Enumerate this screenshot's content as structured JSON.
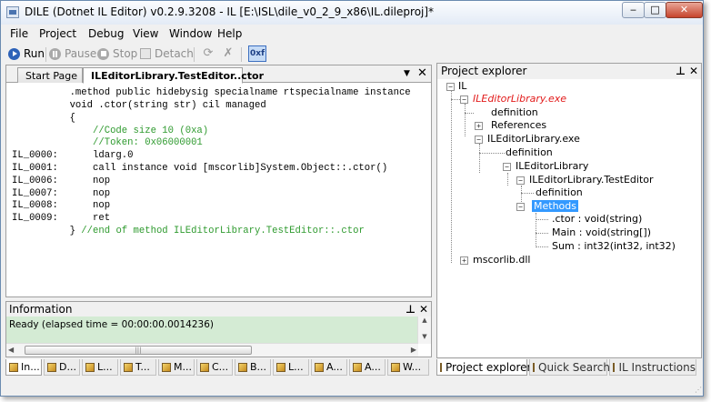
{
  "window": {
    "title": "DILE (Dotnet IL Editor) v0.2.9.3208 - IL [E:\\ISL\\dile_v0_2_9_x86\\IL.dileproj]*",
    "minimize": "‒",
    "maximize": "□",
    "close": "✕"
  },
  "menu": [
    "File",
    "Project",
    "Debug",
    "View",
    "Window",
    "Help"
  ],
  "toolbar": {
    "run": "Run",
    "pause": "Pause",
    "stop": "Stop",
    "detach": "Detach",
    "hex": "0xf"
  },
  "editor": {
    "tabs": [
      "Start Page",
      "ILEditorLibrary.TestEditor..ctor"
    ],
    "dropdown": "▼",
    "close": "✕",
    "lines": [
      {
        "text": "          .method public hidebysig specialname rtspecialname instance",
        "comment": false
      },
      {
        "text": "          void .ctor(string str) cil managed",
        "comment": false
      },
      {
        "text": "          {",
        "comment": false
      },
      {
        "text": "              //Code size 10 (0xa)",
        "comment": true
      },
      {
        "text": "              //Token: 0x06000001",
        "comment": true
      },
      {
        "text": "IL_0000:      ldarg.0",
        "comment": false
      },
      {
        "text": "IL_0001:      call instance void [mscorlib]System.Object::.ctor()",
        "comment": false
      },
      {
        "text": "IL_0006:      nop",
        "comment": false
      },
      {
        "text": "IL_0007:      nop",
        "comment": false
      },
      {
        "text": "IL_0008:      nop",
        "comment": false
      },
      {
        "text": "IL_0009:      ret",
        "comment": false
      }
    ],
    "last_line_code": "          } ",
    "last_line_comment": "//end of method ILEditorLibrary.TestEditor::.ctor"
  },
  "info": {
    "title": "Information",
    "pin": "⊥",
    "close": "✕",
    "text": "Ready (elapsed time = 00:00:00.0014236)",
    "up": "▲",
    "down": "▼",
    "left": "◀",
    "right": "▶",
    "grip": "|||"
  },
  "bottom_tabs": [
    "In...",
    "D...",
    "L...",
    "T...",
    "M...",
    "C...",
    "B...",
    "L...",
    "A...",
    "A...",
    "W..."
  ],
  "explorer": {
    "title": "Project explorer",
    "pin": "⊥",
    "close": "✕",
    "minus": "−",
    "plus": "+",
    "nodes": {
      "root": "IL",
      "exe_red": "ILEditorLibrary.exe",
      "def1": "definition",
      "refs": "References",
      "exe": "ILEditorLibrary.exe",
      "def2": "definition",
      "ns": "ILEditorLibrary",
      "cls": "ILEditorLibrary.TestEditor",
      "def3": "definition",
      "methods": "Methods",
      "m1": ".ctor : void(string)",
      "m2": "Main : void(string[])",
      "m3": "Sum : int32(int32, int32)",
      "mscorlib": "mscorlib.dll"
    },
    "tabs": [
      "Project explorer",
      "Quick Search",
      "IL Instructions"
    ]
  }
}
